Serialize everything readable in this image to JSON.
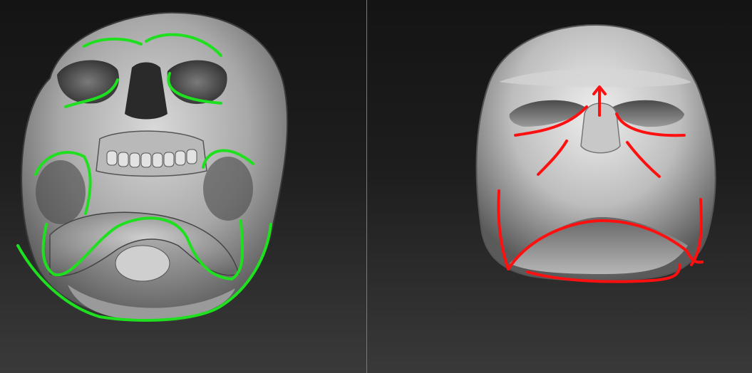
{
  "panels": [
    {
      "id": "skull-viewport",
      "subject": "skull-render",
      "overlay_color": "#1fe01f"
    },
    {
      "id": "face-viewport",
      "subject": "face-mask-render",
      "overlay_color": "#ff1010"
    }
  ],
  "colors": {
    "background_top": "#141414",
    "background_bottom": "#3a3a3a",
    "divider": "#7a7a7a",
    "green_strokes": "#1fe01f",
    "red_strokes": "#ff1010"
  }
}
